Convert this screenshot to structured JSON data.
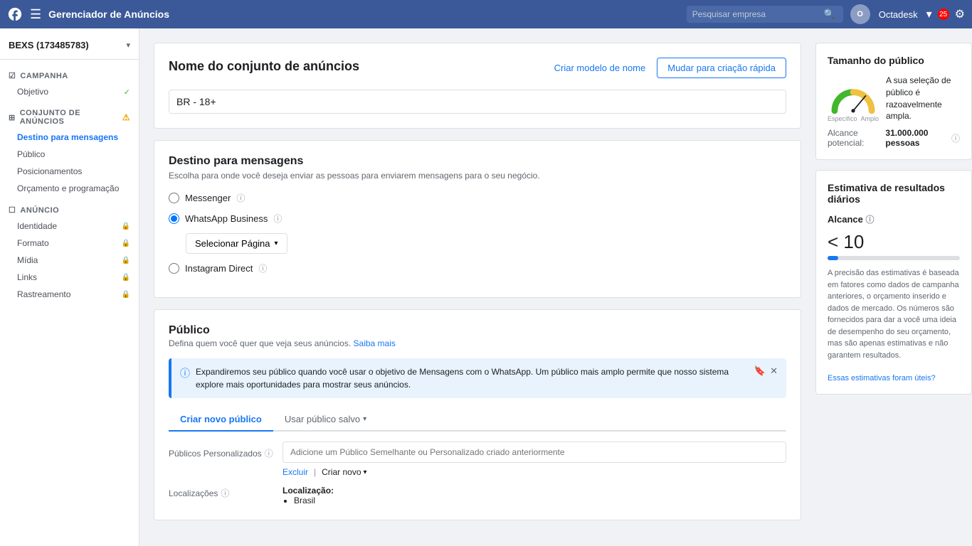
{
  "topbar": {
    "title": "Gerenciador de Anúncios",
    "search_placeholder": "Pesquisar empresa",
    "username": "Octadesk",
    "notification_count": "25"
  },
  "sidebar": {
    "account": {
      "name": "BEXS (173485783)",
      "chevron": "▾"
    },
    "sections": [
      {
        "id": "campanha",
        "label": "Campanha",
        "items": [
          {
            "id": "objetivo",
            "label": "Objetivo",
            "status": "check"
          }
        ]
      },
      {
        "id": "conjunto",
        "label": "Conjunto de anúncios",
        "warning": true,
        "items": [
          {
            "id": "destino",
            "label": "Destino para mensagens",
            "active": true
          },
          {
            "id": "publico",
            "label": "Público"
          },
          {
            "id": "posicionamentos",
            "label": "Posicionamentos"
          },
          {
            "id": "orcamento",
            "label": "Orçamento e programação"
          }
        ]
      },
      {
        "id": "anuncio",
        "label": "Anúncio",
        "items": [
          {
            "id": "identidade",
            "label": "Identidade",
            "status": "lock"
          },
          {
            "id": "formato",
            "label": "Formato",
            "status": "lock"
          },
          {
            "id": "midia",
            "label": "Mídia",
            "status": "lock"
          },
          {
            "id": "links",
            "label": "Links",
            "status": "lock"
          },
          {
            "id": "rastreamento",
            "label": "Rastreamento",
            "status": "lock"
          }
        ]
      }
    ]
  },
  "main": {
    "ad_set_name": {
      "title": "Nome do conjunto de anúncios",
      "link": "Criar modelo de nome",
      "quick_create_btn": "Mudar para criação rápida",
      "input_value": "BR - 18+"
    },
    "destino": {
      "title": "Destino para mensagens",
      "desc": "Escolha para onde você deseja enviar as pessoas para enviarem mensagens para o seu negócio.",
      "options": [
        {
          "id": "messenger",
          "label": "Messenger",
          "checked": false
        },
        {
          "id": "whatsapp",
          "label": "WhatsApp Business",
          "checked": true
        },
        {
          "id": "instagram",
          "label": "Instagram Direct",
          "checked": false
        }
      ],
      "select_page_btn": "Selecionar Página"
    },
    "publico": {
      "title": "Público",
      "desc": "Defina quem você quer que veja seus anúncios.",
      "saiba_mais": "Saiba mais",
      "info_text": "Expandiremos seu público quando você usar o objetivo de Mensagens com o WhatsApp. Um público mais amplo permite que nosso sistema explore mais oportunidades para mostrar seus anúncios.",
      "tabs": [
        {
          "id": "criar",
          "label": "Criar novo público",
          "active": true
        },
        {
          "id": "salvo",
          "label": "Usar público salvo"
        }
      ],
      "publicos_label": "Públicos Personalizados",
      "publicos_placeholder": "Adicione um Público Semelhante ou Personalizado criado anteriormente",
      "excluir": "Excluir",
      "criar_novo": "Criar novo",
      "localizacoes_label": "Localizações",
      "localizacao_title": "Localização:",
      "localizacao_value": "Brasil"
    }
  },
  "right_panel": {
    "tamanho": {
      "title": "Tamanho do público",
      "desc": "A sua seleção de público é razoavelmente ampla.",
      "reach_label": "Alcance potencial:",
      "reach_value": "31.000.000 pessoas"
    },
    "estimativa": {
      "title": "Estimativa de resultados diários",
      "subtitle": "Alcance",
      "value": "< 10",
      "note": "A precisão das estimativas é baseada em fatores como dados de campanha anteriores, o orçamento inserido e dados de mercado. Os números são fornecidos para dar a você uma ideia de desempenho do seu orçamento, mas são apenas estimativas e não garantem resultados.",
      "link": "Essas estimativas foram úteis?"
    }
  }
}
